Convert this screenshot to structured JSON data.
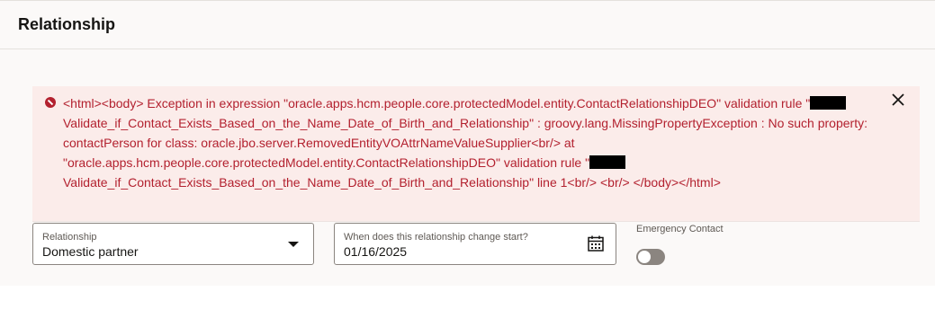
{
  "header": {
    "title": "Relationship"
  },
  "error": {
    "text_part1": "<html><body> Exception in expression \"oracle.apps.hcm.people.core.protectedModel.entity.ContactRelationshipDEO\" validation rule \"",
    "text_part2": "Validate_if_Contact_Exists_Based_on_the_Name_Date_of_Birth_and_Relationship\" : groovy.lang.MissingPropertyException : No such property: contactPerson for class: oracle.jbo.server.RemovedEntityVOAttrNameValueSupplier<br/> at \"oracle.apps.hcm.people.core.protectedModel.entity.ContactRelationshipDEO\" validation rule \"",
    "text_part3": "Validate_if_Contact_Exists_Based_on_the_Name_Date_of_Birth_and_Relationship\" line 1<br/> <br/> </body></html>",
    "icon": "error-circle-icon",
    "close_icon": "close-icon",
    "color": "#b3212f",
    "background": "#fbecea"
  },
  "form": {
    "relationship": {
      "label": "Relationship",
      "value": "Domestic partner"
    },
    "change_start": {
      "label": "When does this relationship change start?",
      "value": "01/16/2025"
    },
    "emergency_contact": {
      "label": "Emergency Contact",
      "checked": false
    }
  }
}
